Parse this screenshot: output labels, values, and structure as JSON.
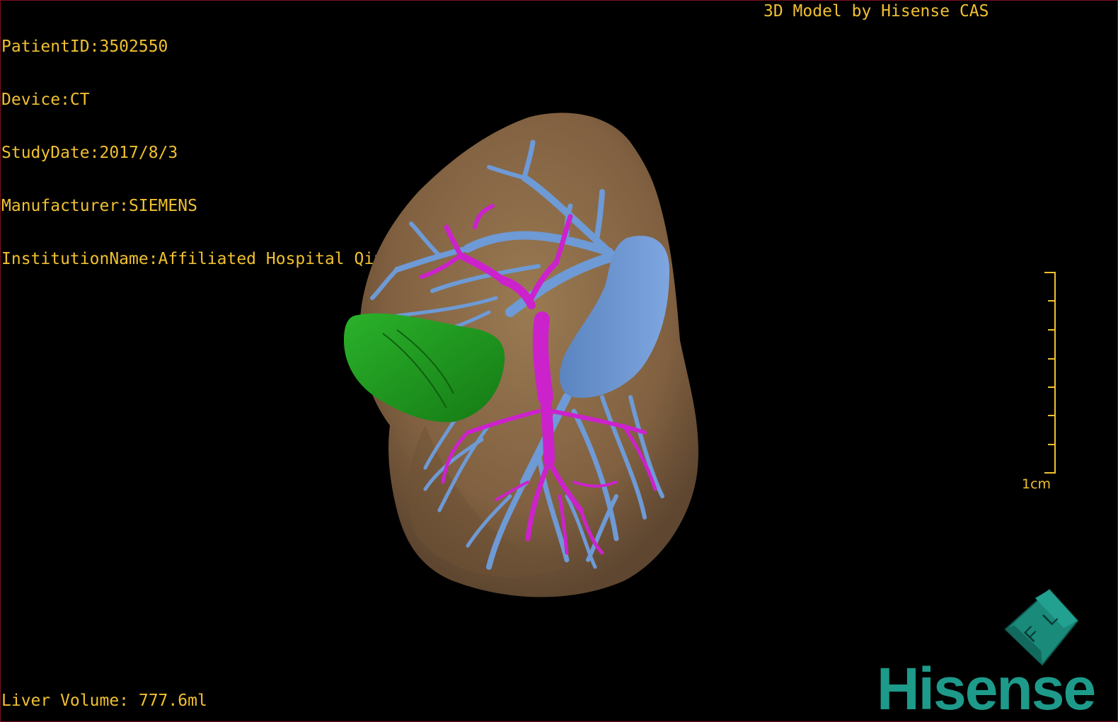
{
  "patient_info": {
    "patient_id": "PatientID:3502550",
    "device": "Device:CT",
    "study_date": "StudyDate:2017/8/3",
    "manufacturer": "Manufacturer:SIEMENS",
    "institution": "InstitutionName:Affiliated Hospital Qingdao University-C"
  },
  "watermark": "3D Model by Hisense CAS",
  "liver_volume": "Liver Volume: 777.6ml",
  "scale": {
    "label": "1cm"
  },
  "logo": {
    "text": "Hisense",
    "cube_letters": [
      "F",
      "L"
    ]
  },
  "colors": {
    "overlay_text": "#f0c030",
    "liver": "#8a6a45",
    "portal_vein": "#6e9ad6",
    "hepatic_artery": "#cc22cc",
    "gallbladder": "#1e9a1e",
    "brand": "#1d9a8a"
  }
}
